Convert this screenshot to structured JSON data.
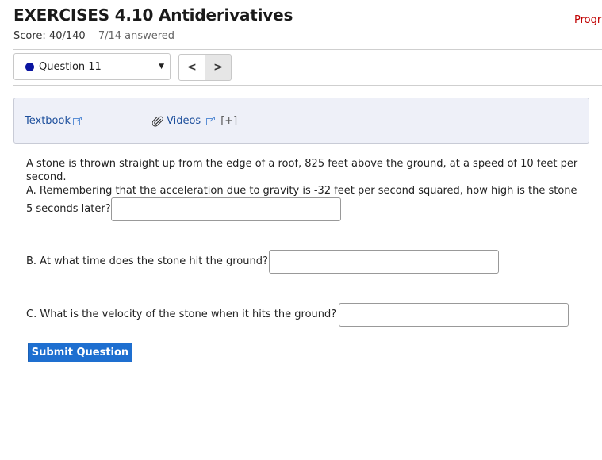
{
  "header": {
    "title": "EXERCISES 4.10 Antiderivatives",
    "progress_link": "Progr",
    "score": "Score: 40/140",
    "answered": "7/14 answered"
  },
  "question_nav": {
    "selected": "Question 11",
    "status_color": "#0a14a0",
    "prev_symbol": "<",
    "next_symbol": ">"
  },
  "resources": {
    "textbook_label": "Textbook",
    "videos_label": "Videos",
    "expand_label": "[+]"
  },
  "question": {
    "intro_line1": "A stone is thrown straight up from the edge of a roof, 825 feet above the ground, at a speed of 10 feet per",
    "intro_line2": "second.",
    "part_a_line1": "A. Remembering that the acceleration due to gravity is -32 feet per second squared, how high is the stone",
    "part_a_line2": "5 seconds later?",
    "part_a_value": "",
    "part_b": "B. At what time does the stone hit the ground?",
    "part_b_value": "",
    "part_c": "C. What is the velocity of the stone when it hits the ground?",
    "part_c_value": ""
  },
  "actions": {
    "submit_label": "Submit Question"
  },
  "colors": {
    "accent": "#1e6fd0",
    "link": "#1d4f9c",
    "progress_link": "#c00000"
  }
}
